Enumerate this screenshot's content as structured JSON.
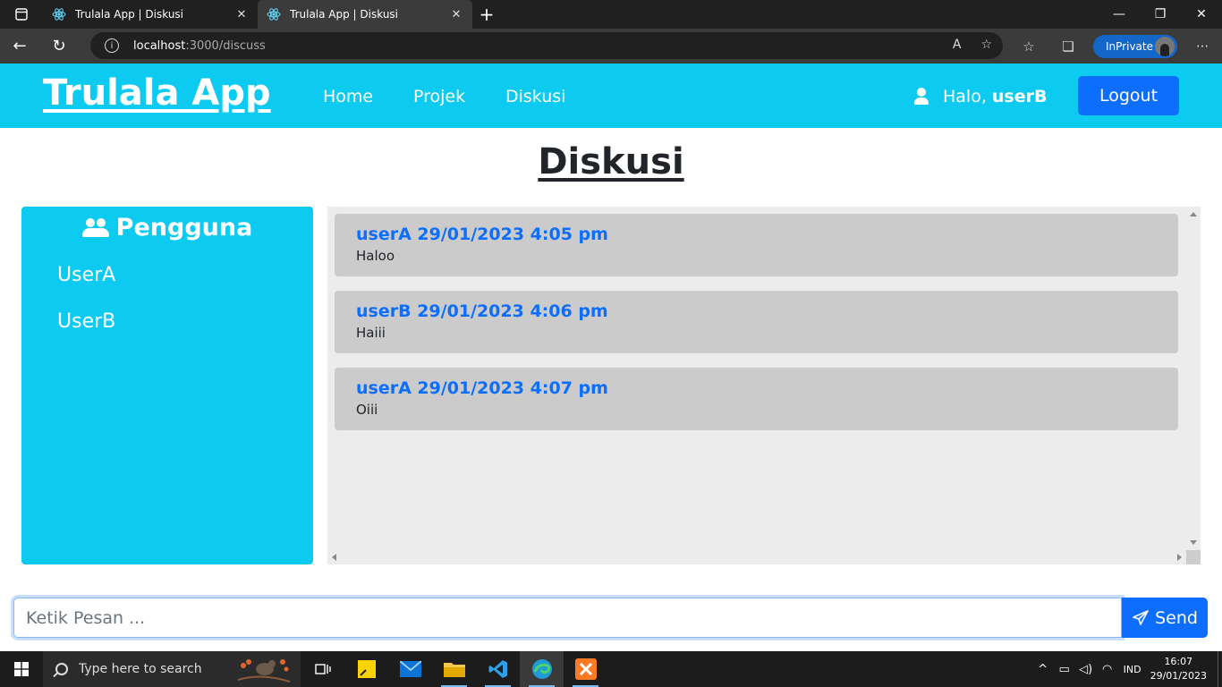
{
  "browser": {
    "tabs": [
      {
        "title": "Trulala App | Diskusi",
        "active": false
      },
      {
        "title": "Trulala App | Diskusi",
        "active": true
      }
    ],
    "url_host": "localhost",
    "url_path": ":3000/discuss",
    "inprivate_label": "InPrivate"
  },
  "navbar": {
    "brand": "Trulala App",
    "links": [
      "Home",
      "Projek",
      "Diskusi"
    ],
    "greeting_prefix": "Halo,",
    "username": "userB",
    "logout_label": "Logout",
    "background": "#0dcaf0"
  },
  "page": {
    "title": "Diskusi"
  },
  "users_panel": {
    "heading": "Pengguna",
    "users": [
      "UserA",
      "UserB"
    ]
  },
  "messages": [
    {
      "user": "userA",
      "time": "29/01/2023 4:05 pm",
      "text": "Haloo"
    },
    {
      "user": "userB",
      "time": "29/01/2023 4:06 pm",
      "text": "Haiii"
    },
    {
      "user": "userA",
      "time": "29/01/2023 4:07 pm",
      "text": "Oiii"
    }
  ],
  "composer": {
    "placeholder": "Ketik Pesan ...",
    "value": "",
    "send_label": "Send",
    "accent": "#0d6efd"
  },
  "taskbar": {
    "search_placeholder": "Type here to search",
    "apps": [
      "task-view",
      "sticky-notes",
      "mail",
      "file-explorer",
      "vscode",
      "edge",
      "xampp"
    ],
    "language": "IND",
    "time": "16:07",
    "date": "29/01/2023"
  }
}
